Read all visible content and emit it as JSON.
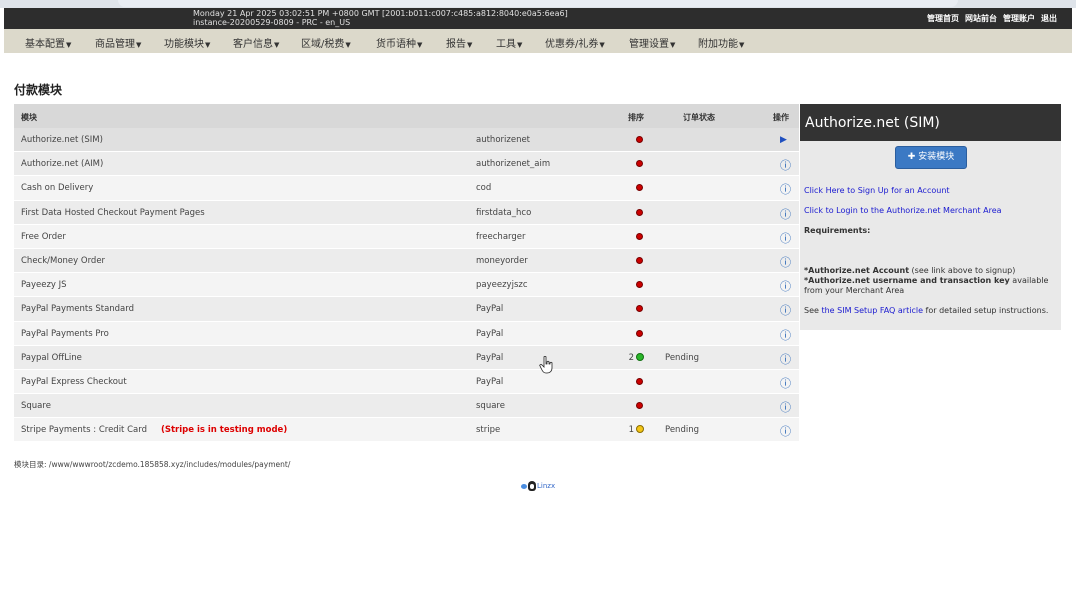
{
  "header": {
    "info_line1": "Monday 21 Apr 2025 03:02:51 PM +0800 GMT [2001:b011:c007:c485:a812:8040:e0a5:6ea6]",
    "info_line2": "instance-20200529-0809 - PRC - en_US",
    "links": [
      "管理首页",
      "网站前台",
      "管理账户",
      "退出"
    ]
  },
  "nav": {
    "items": [
      "基本配置",
      "商品管理",
      "功能模块",
      "客户信息",
      "区域/税费",
      "货币语种",
      "报告",
      "工具",
      "优惠券/礼券",
      "管理设置",
      "附加功能"
    ]
  },
  "page_title": "付款模块",
  "table": {
    "headers": {
      "module": "模块",
      "sort": "排序",
      "order_status": "订单状态",
      "action": "操作"
    },
    "rows": [
      {
        "title": "Authorize.net (SIM)",
        "code": "authorizenet",
        "sort": "",
        "status_dot": "red",
        "order_status": "",
        "action": "play-icon"
      },
      {
        "title": "Authorize.net (AIM)",
        "code": "authorizenet_aim",
        "sort": "",
        "status_dot": "red",
        "order_status": "",
        "action": "info-icon"
      },
      {
        "title": "Cash on Delivery",
        "code": "cod",
        "sort": "",
        "status_dot": "red",
        "order_status": "",
        "action": "info-icon"
      },
      {
        "title": "First Data Hosted Checkout Payment Pages",
        "code": "firstdata_hco",
        "sort": "",
        "status_dot": "red",
        "order_status": "",
        "action": "info-icon"
      },
      {
        "title": "Free Order",
        "code": "freecharger",
        "sort": "",
        "status_dot": "red",
        "order_status": "",
        "action": "info-icon"
      },
      {
        "title": "Check/Money Order",
        "code": "moneyorder",
        "sort": "",
        "status_dot": "red",
        "order_status": "",
        "action": "info-icon"
      },
      {
        "title": "Payeezy JS",
        "code": "payeezyjszc",
        "sort": "",
        "status_dot": "red",
        "order_status": "",
        "action": "info-icon"
      },
      {
        "title": "PayPal Payments Standard",
        "code": "PayPal",
        "sort": "",
        "status_dot": "red",
        "order_status": "",
        "action": "info-icon"
      },
      {
        "title": "PayPal Payments Pro",
        "code": "PayPal",
        "sort": "",
        "status_dot": "red",
        "order_status": "",
        "action": "info-icon"
      },
      {
        "title": "Paypal OffLine",
        "code": "PayPal",
        "sort": "2",
        "status_dot": "green",
        "order_status": "Pending",
        "action": "info-icon"
      },
      {
        "title": "PayPal Express Checkout",
        "code": "PayPal",
        "sort": "",
        "status_dot": "red",
        "order_status": "",
        "action": "info-icon"
      },
      {
        "title": "Square",
        "code": "square",
        "sort": "",
        "status_dot": "red",
        "order_status": "",
        "action": "info-icon"
      },
      {
        "title": "Stripe Payments : Credit Card",
        "title_note": "(Stripe is in testing mode)",
        "code": "stripe",
        "sort": "1",
        "status_dot": "yellow",
        "order_status": "Pending",
        "action": "info-icon"
      }
    ]
  },
  "sidebar": {
    "title": "Authorize.net (SIM)",
    "install_button": "安装模块",
    "signup_link": "Click Here to Sign Up for an Account",
    "login_link": "Click to Login to the Authorize.net Merchant Area",
    "requirements_label": "Requirements:",
    "req1_bold": "*Authorize.net Account",
    "req1_text": " (see link above to signup)",
    "req2_bold": "*Authorize.net username and transaction key",
    "req2_text": " available from your Merchant Area",
    "faq_prefix": "See ",
    "faq_link": "the SIM Setup FAQ article",
    "faq_suffix": " for detailed setup instructions."
  },
  "module_dir": "模块目录: /www/wwwroot/zcdemo.185858.xyz/includes/modules/payment/",
  "footer_logo_text": "Linzx",
  "colors": {
    "header_bg": "#2d2d2d",
    "nav_bg": "#dcd9cb",
    "accent_button": "#3b79c4",
    "link": "#1a1ad0"
  }
}
